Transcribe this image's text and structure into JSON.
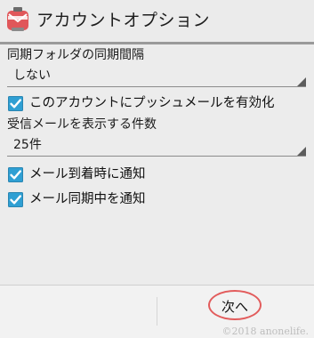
{
  "title_bar": {
    "title": "アカウントオプション",
    "icon": "mail-robot-app-icon"
  },
  "settings": {
    "sync_frequency_label": "同期フォルダの同期間隔",
    "sync_frequency_value": "しない",
    "push_mail_checkbox": {
      "label": "このアカウントにプッシュメールを有効化",
      "checked": true
    },
    "receive_count_label": "受信メールを表示する件数",
    "receive_count_value": "25件",
    "notify_new_mail_checkbox": {
      "label": "メール到着時に通知",
      "checked": true
    },
    "notify_sync_checkbox": {
      "label": "メール同期中を通知",
      "checked": true
    }
  },
  "footer": {
    "next_label": "次へ",
    "watermark": "©2018 anonelife."
  },
  "colors": {
    "checkbox_accent": "#2f9fd3",
    "highlight_circle": "#e25c5c"
  }
}
